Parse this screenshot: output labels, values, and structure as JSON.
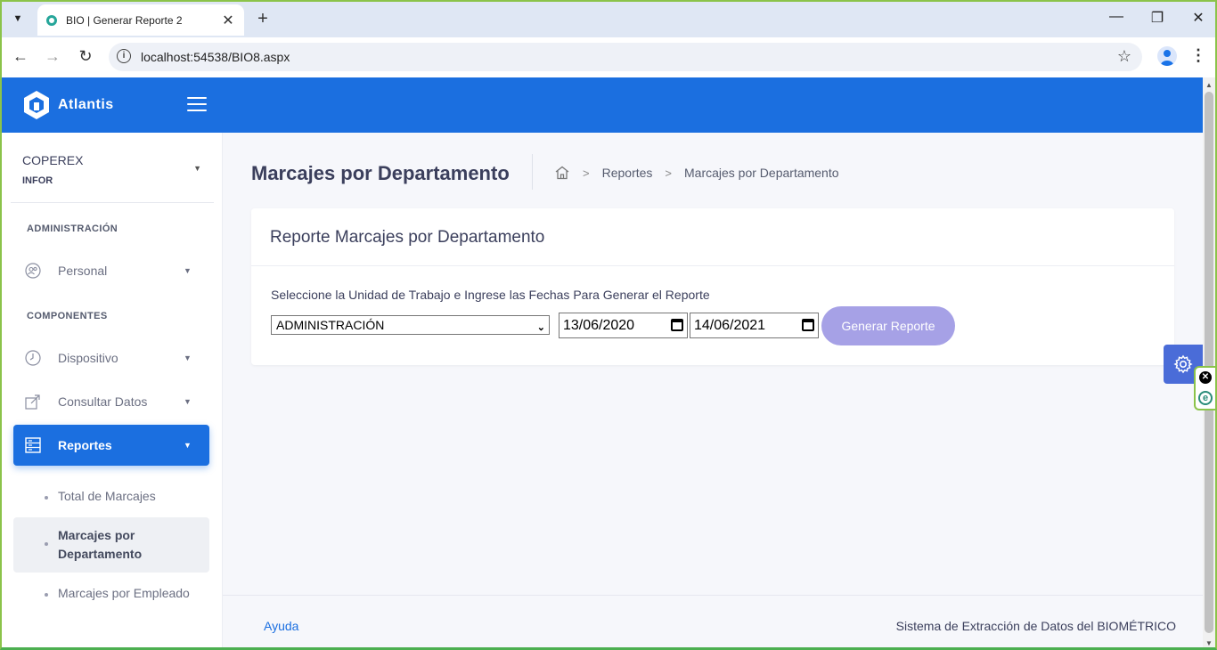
{
  "browser": {
    "tab_title": "BIO | Generar Reporte 2",
    "url": "localhost:54538/BIO8.aspx",
    "new_tab": "+",
    "win_min": "—",
    "win_restore": "❐",
    "win_close": "✕",
    "tab_close": "✕"
  },
  "brand": {
    "name": "Atlantis"
  },
  "company": {
    "name": "COPEREX",
    "sub": "INFOR"
  },
  "sidebar": {
    "sections": [
      {
        "label": "ADMINISTRACIÓN"
      },
      {
        "label": "COMPONENTES"
      }
    ],
    "items": [
      {
        "label": "Personal",
        "icon": "users-icon"
      },
      {
        "label": "Dispositivo",
        "icon": "clock-icon"
      },
      {
        "label": "Consultar Datos",
        "icon": "export-icon"
      },
      {
        "label": "Reportes",
        "icon": "server-icon",
        "active": true
      }
    ],
    "sub_items": [
      {
        "label": "Total de Marcajes"
      },
      {
        "label_line1": "Marcajes por",
        "label_line2": "Departamento",
        "current": true
      },
      {
        "label": "Marcajes por Empleado"
      }
    ]
  },
  "page": {
    "title": "Marcajes por Departamento",
    "breadcrumb": [
      "Reportes",
      "Marcajes por Departamento"
    ]
  },
  "card": {
    "title": "Reporte Marcajes por Departamento",
    "instructions": "Seleccione la Unidad de Trabajo e Ingrese las Fechas Para Generar el Reporte",
    "unit_selected": "ADMINISTRACIÓN",
    "date_from": "13/06/2020",
    "date_to": "14/06/2021",
    "button_label": "Generar Reporte"
  },
  "footer": {
    "help": "Ayuda",
    "right": "Sistema de Extracción de Datos del BIOMÉTRICO"
  },
  "colors": {
    "primary": "#1b6fe0",
    "button_disabled": "#a6a1e6",
    "fab": "#4a6cd8"
  }
}
